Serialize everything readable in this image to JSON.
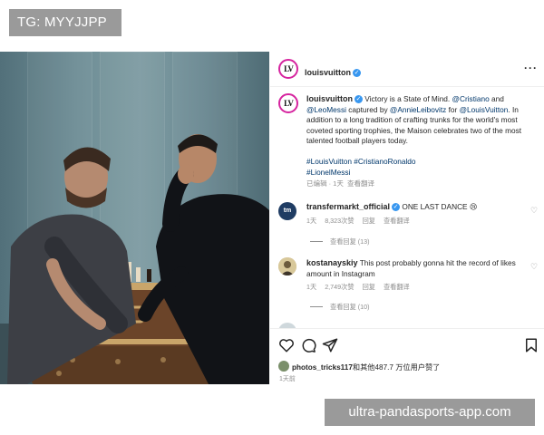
{
  "watermarks": {
    "top": "TG: MYYJJPP",
    "bottom": "ultra-pandasports-app.com"
  },
  "post": {
    "account": "louisvuitton",
    "logo_text": "LV",
    "more_icon": "more-horizontal-icon",
    "caption": {
      "text_1": " Victory is a State of Mind. ",
      "mention_1": "@Cristiano",
      "text_2": " and ",
      "mention_2": "@LeoMessi",
      "text_3": " captured by ",
      "mention_3": "@AnnieLeibovitz",
      "text_4": " for ",
      "mention_4": "@LouisVuitton",
      "text_5": ". In addition to a long tradition of crafting trunks for the world's most coveted sporting trophies, the Maison celebrates two of the most talented football players today.",
      "hashtags_line1": "#LouisVuitton #CristianoRonaldo",
      "hashtags_line2": "#LionelMessi",
      "meta": "已编辑 · 1天",
      "translate": "查看翻译"
    },
    "comments": [
      {
        "user": "transfermarkt_official",
        "avatar_text": "tm",
        "text": "ONE LAST DANCE",
        "emoji": "😢",
        "time": "1天",
        "likes": "8,323次赞",
        "reply": "回复",
        "translate": "查看翻译",
        "view_replies": "查看回复 (13)"
      },
      {
        "user": "kostanayskiy",
        "text": "This post probably gonna hit the record of likes amount in Instagram",
        "time": "1天",
        "likes": "2,749次赞",
        "reply": "回复",
        "view_replies": "查看回复 (10)"
      }
    ],
    "liked_by_user": "photos_tricks117",
    "liked_by_rest": "和其他487.7 万位用户赞了",
    "posted_time": "1天前",
    "icons": [
      "heart-icon",
      "comment-icon",
      "share-icon",
      "bookmark-icon"
    ]
  }
}
